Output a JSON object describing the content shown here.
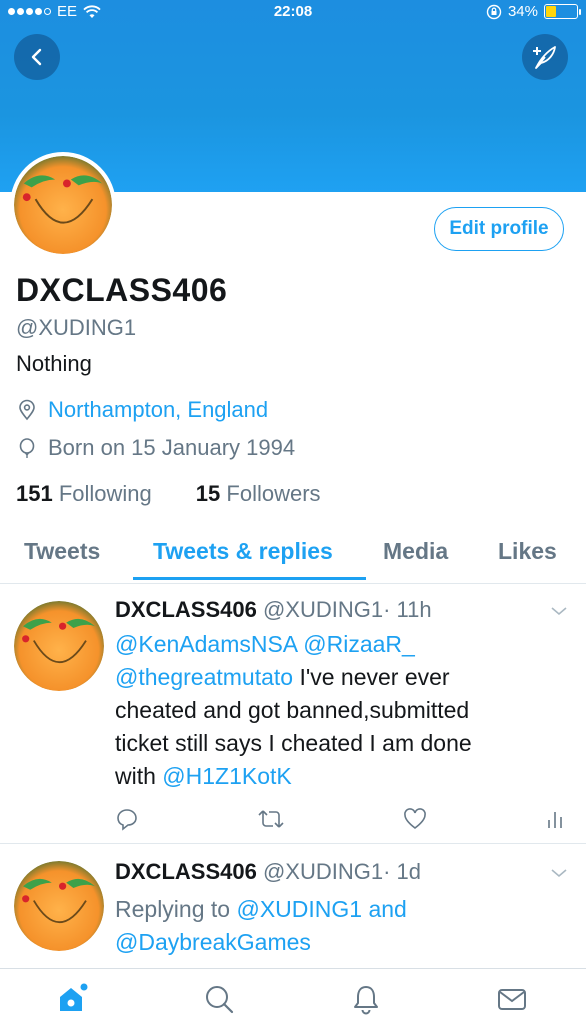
{
  "status": {
    "carrier": "EE",
    "time": "22:08",
    "battery": "34%",
    "battery_level": 0.34
  },
  "profile": {
    "name": "DXCLASS406",
    "handle": "@XUDING1",
    "bio": "Nothing",
    "location": "Northampton, England",
    "birthday": "Born on 15 January 1994",
    "following_count": "151",
    "following_label": "Following",
    "followers_count": "15",
    "followers_label": "Followers",
    "edit_label": "Edit profile"
  },
  "tabs": [
    {
      "label": "Tweets"
    },
    {
      "label": "Tweets & replies"
    },
    {
      "label": "Media"
    },
    {
      "label": "Likes"
    }
  ],
  "tweets": [
    {
      "name": "DXCLASS406",
      "handle": "@XUDING1",
      "time": "· 11h",
      "mentions": [
        "@KenAdamsNSA",
        "@RizaaR_",
        "@thegreatmutato"
      ],
      "text_line1": "I've never ever",
      "text_line2": "cheated and got banned,submitted",
      "text_line3": "ticket still says I cheated I am done",
      "text_with": "with",
      "end_mention": "@H1Z1KotK"
    },
    {
      "name": "DXCLASS406",
      "handle": "@XUDING1",
      "time": "· 1d",
      "replying_prefix": "Replying to",
      "reply_mention1": "@XUDING1",
      "reply_and": "and",
      "reply_mention2": "@DaybreakGames"
    }
  ],
  "colors": {
    "accent": "#1da1f2",
    "header": "#1b95e0",
    "muted": "#657786"
  }
}
